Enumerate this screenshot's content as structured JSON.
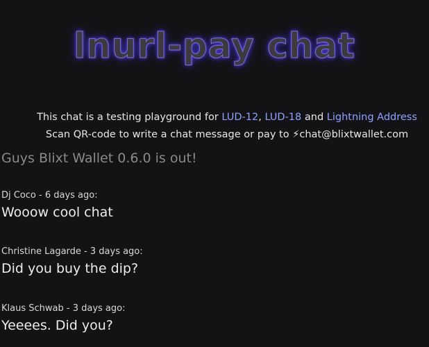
{
  "header": {
    "title": "lnurl-pay chat"
  },
  "info": {
    "line1_prefix": "This chat is a testing playground for ",
    "link_lud12": "LUD-12",
    "sep1": ", ",
    "link_lud18": "LUD-18",
    "sep2": " and ",
    "link_lightning_address": "Lightning Address",
    "line2_prefix": "Scan QR-code to write a chat message or pay to ",
    "bolt_icon": "⚡",
    "address": "chat@blixtwallet.com"
  },
  "messages": [
    {
      "meta": "",
      "text": "Guys Blixt Wallet 0.6.0 is out!"
    },
    {
      "meta": "Dj Coco - 6 days ago:",
      "text": "Wooow cool chat"
    },
    {
      "meta": "Christine Lagarde - 3 days ago:",
      "text": "Did you buy the dip?"
    },
    {
      "meta": "Klaus Schwab - 3 days ago:",
      "text": "Yeeees. Did you?"
    }
  ]
}
